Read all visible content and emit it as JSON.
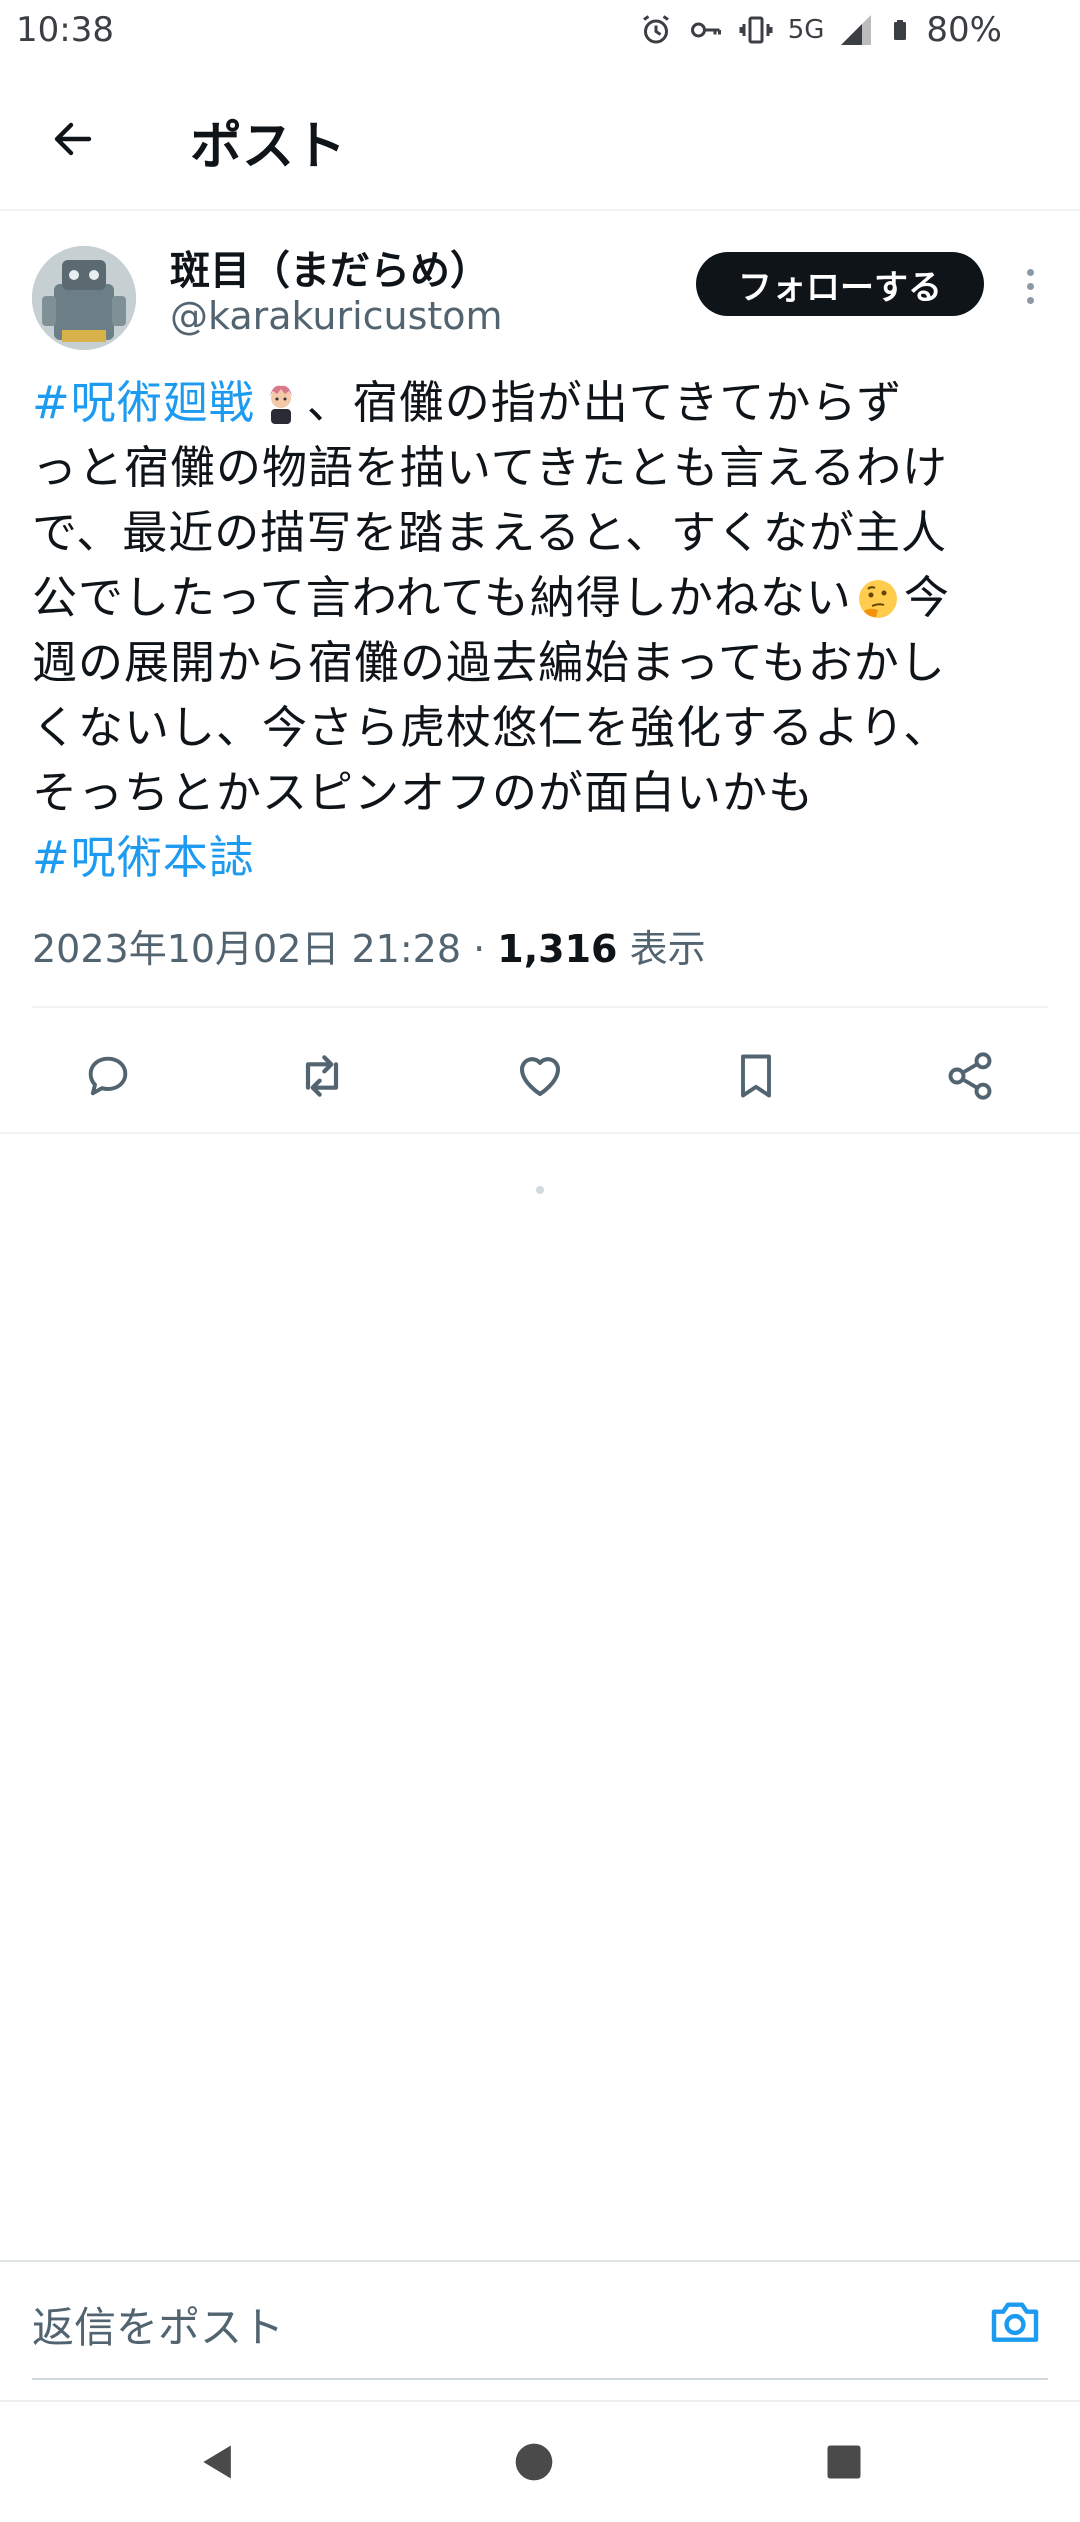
{
  "status_bar": {
    "time": "10:38",
    "network": "5G",
    "battery": "80%"
  },
  "header": {
    "title": "ポスト"
  },
  "post": {
    "author_name": "斑目（まだらめ）",
    "author_handle": "@karakuricustom",
    "follow_label": "フォローする",
    "lines": [
      {
        "hashtag": "#呪術廻戦",
        "after_emoji": "、宿儺の指が出てきてからず"
      },
      {
        "text": "っと宿儺の物語を描いてきたとも言えるわけ"
      },
      {
        "text": "で、最近の描写を踏まえると、すくなが主人"
      },
      {
        "text": "公でしたって言われても納得しかねない",
        "after_emoji": "今"
      },
      {
        "text": "週の展開から宿儺の過去編始まってもおかし"
      },
      {
        "text": "くないし、今さら虎杖悠仁を強化するより、"
      },
      {
        "text": "そっちとかスピンオフのが面白いかも"
      },
      {
        "hashtag": "#呪術本誌"
      }
    ],
    "datetime": "2023年10月02日 21:28",
    "separator": "·",
    "views_count": "1,316",
    "views_label": "表示"
  },
  "actions": [
    {
      "icon": "reply-icon"
    },
    {
      "icon": "repost-icon"
    },
    {
      "icon": "like-icon"
    },
    {
      "icon": "bookmark-icon"
    },
    {
      "icon": "share-icon"
    }
  ],
  "reply": {
    "placeholder": "返信をポスト"
  },
  "colors": {
    "accent": "#1d9bf0",
    "text": "#0f1419",
    "secondary": "#536471",
    "follow_bg": "#0f1419"
  }
}
